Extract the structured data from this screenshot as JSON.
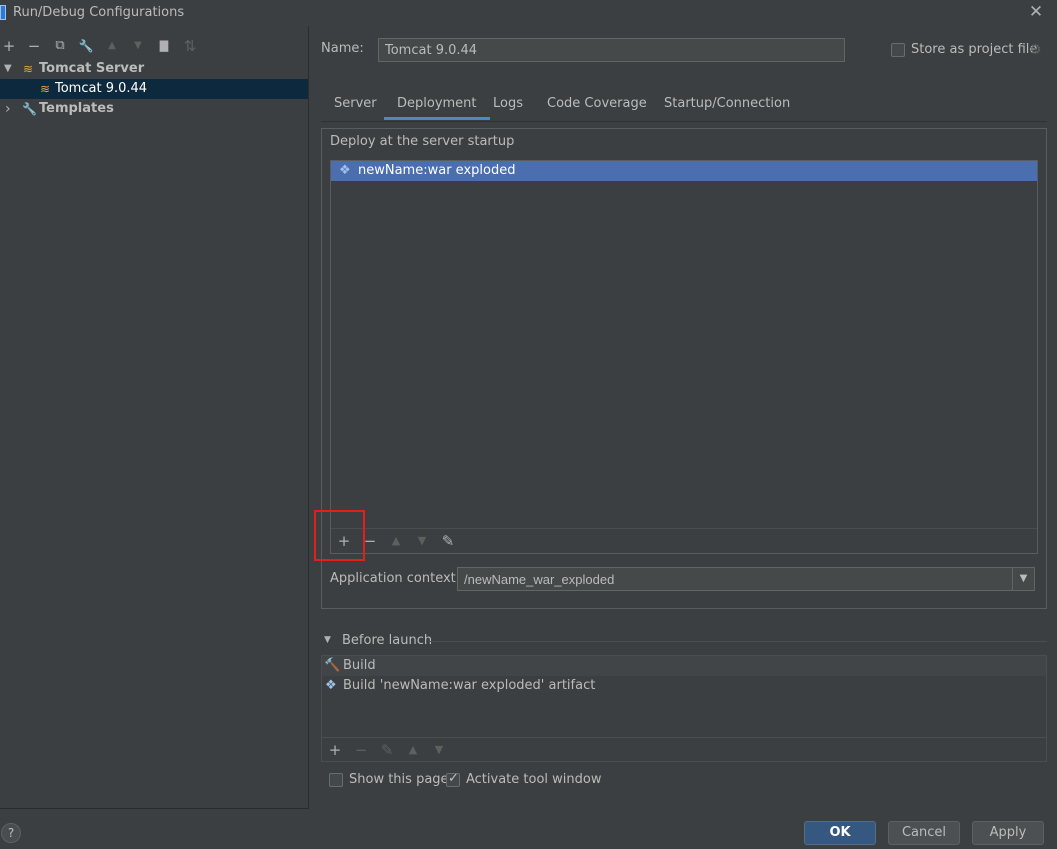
{
  "window": {
    "title": "Run/Debug Configurations",
    "close_glyph": "✕"
  },
  "left_toolbar": {
    "add": "+",
    "remove": "−",
    "copy": "⧉",
    "edit": "🔧",
    "up": "▲",
    "down": "▼",
    "folder": "▇",
    "sort": "⇅"
  },
  "tree": {
    "group": "Tomcat Server",
    "item": "Tomcat 9.0.44",
    "templates": "Templates",
    "expanded_glyph": "▼",
    "collapsed_glyph": "›"
  },
  "name_field": {
    "label": "Name:",
    "value": "Tomcat 9.0.44"
  },
  "store_project": {
    "label": "Store as project file",
    "checked": false
  },
  "tabs": [
    {
      "label": "Server",
      "active": false
    },
    {
      "label": "Deployment",
      "active": true
    },
    {
      "label": "Logs",
      "active": false
    },
    {
      "label": "Code Coverage",
      "active": false
    },
    {
      "label": "Startup/Connection",
      "active": false
    }
  ],
  "deploy": {
    "title": "Deploy at the server startup",
    "items": [
      "newName:war exploded"
    ],
    "toolbar": {
      "add": "+",
      "remove": "−",
      "up": "▲",
      "down": "▼",
      "edit": "✎"
    }
  },
  "app_context": {
    "label": "Application context:",
    "value": "/newName_war_exploded",
    "drop_glyph": "▼"
  },
  "before_launch": {
    "title": "Before launch",
    "items": [
      "Build",
      "Build 'newName:war exploded' artifact"
    ],
    "toolbar": {
      "add": "+",
      "remove": "−",
      "edit": "✎",
      "up": "▲",
      "down": "▼"
    }
  },
  "options": {
    "show_page": {
      "label": "Show this page",
      "checked": false
    },
    "activate_tool": {
      "label": "Activate tool window",
      "checked": true
    }
  },
  "buttons": {
    "ok": "OK",
    "cancel": "Cancel",
    "apply": "Apply",
    "help": "?"
  },
  "colors": {
    "background": "#3c3f41",
    "selection": "#4b6eaf",
    "tree_selection": "#0d293e",
    "highlight_box": "#e2201a",
    "primary_button": "#365880"
  }
}
